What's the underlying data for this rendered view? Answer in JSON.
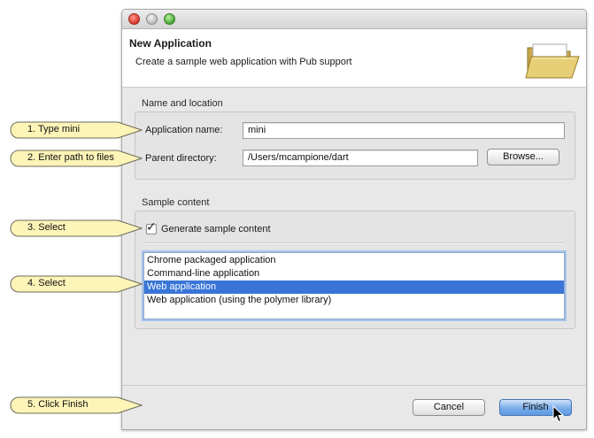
{
  "window": {
    "controls": [
      "close",
      "minimize",
      "zoom"
    ]
  },
  "header": {
    "title": "New Application",
    "description": "Create a sample web application with Pub support",
    "icon": "folder-icon"
  },
  "name_location": {
    "group_label": "Name and location",
    "app_name_label": "Application name:",
    "app_name_value": "mini",
    "parent_dir_label": "Parent directory:",
    "parent_dir_value": "/Users/mcampione/dart",
    "browse_label": "Browse..."
  },
  "sample_content": {
    "group_label": "Sample content",
    "generate_label": "Generate sample content",
    "generate_checked": true,
    "templates": [
      {
        "label": "Chrome packaged application",
        "selected": false
      },
      {
        "label": "Command-line application",
        "selected": false
      },
      {
        "label": "Web application",
        "selected": true
      },
      {
        "label": "Web application (using the polymer library)",
        "selected": false
      }
    ]
  },
  "footer": {
    "cancel_label": "Cancel",
    "finish_label": "Finish"
  },
  "callouts": [
    {
      "text": "1. Type mini"
    },
    {
      "text": "2. Enter path to files"
    },
    {
      "text": "3. Select"
    },
    {
      "text": "4. Select"
    },
    {
      "text": "5. Click Finish"
    }
  ],
  "colors": {
    "callout_fill": "#fdf4b8",
    "selection": "#3875d7",
    "default_button": "#6ea4e6"
  }
}
